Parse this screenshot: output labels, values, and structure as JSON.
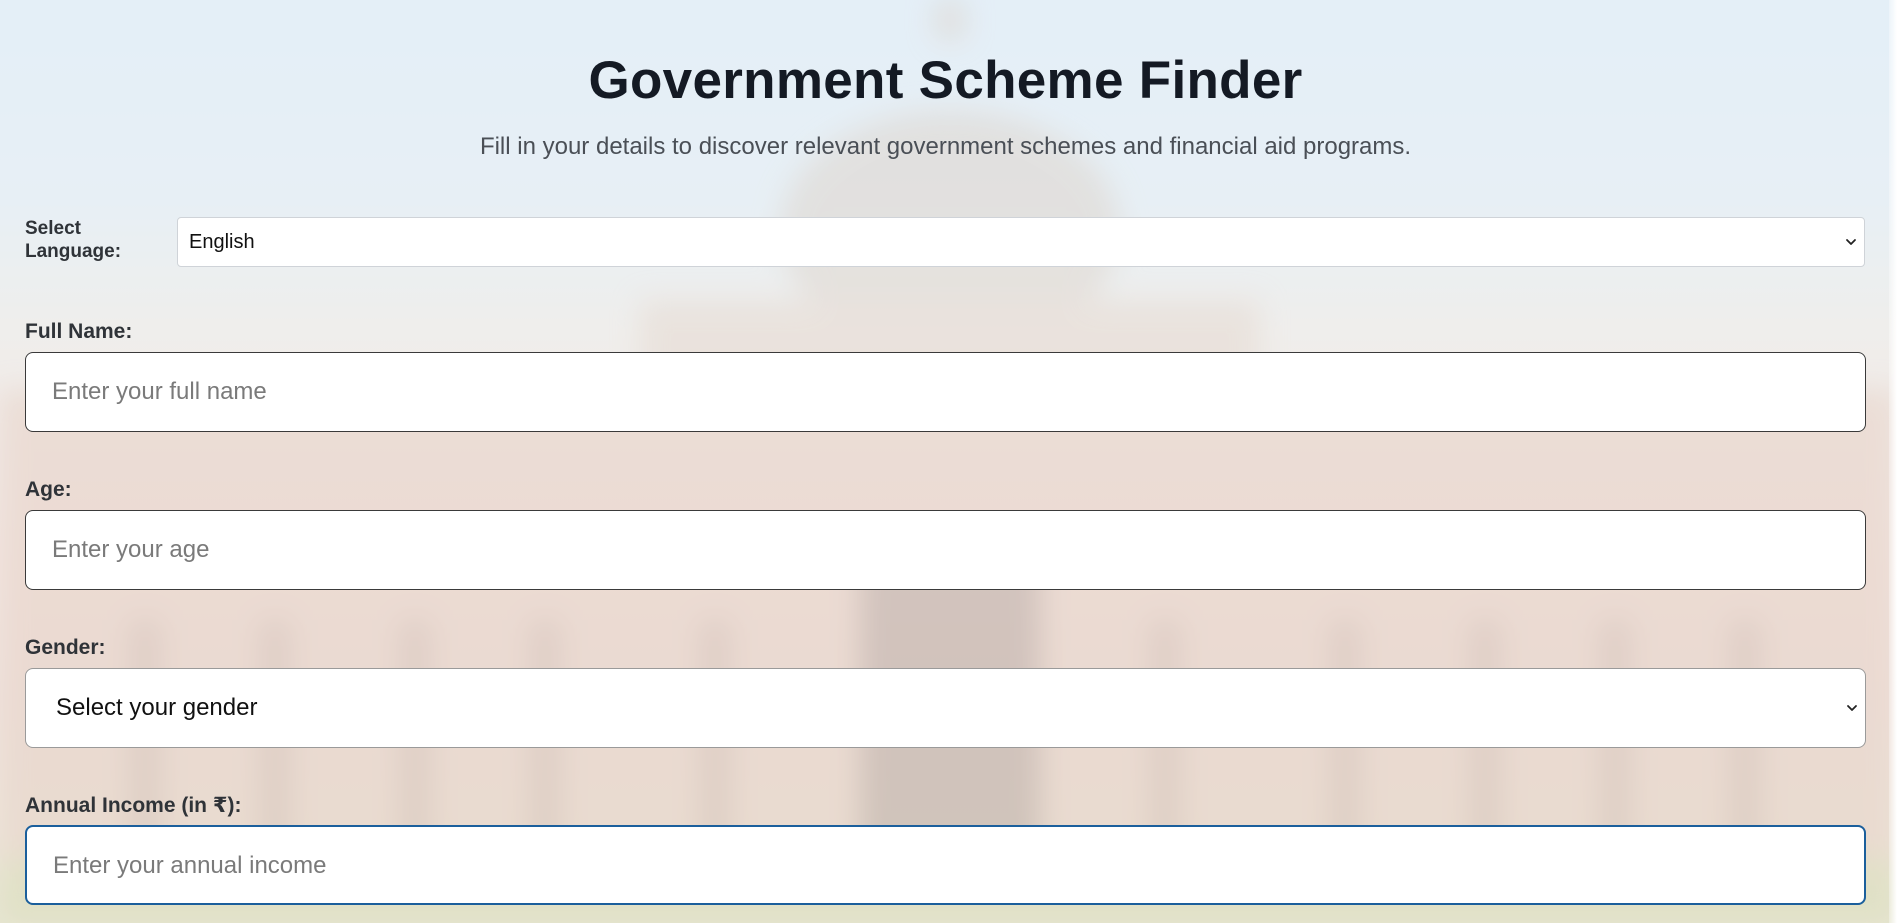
{
  "header": {
    "title": "Government Scheme Finder",
    "subtitle": "Fill in your details to discover relevant government schemes and financial aid programs."
  },
  "language": {
    "label_line1": "Select",
    "label_line2": "Language:",
    "selected": "English",
    "icon": "chevron-down-icon"
  },
  "form": {
    "full_name": {
      "label": "Full Name:",
      "placeholder": "Enter your full name",
      "value": ""
    },
    "age": {
      "label": "Age:",
      "placeholder": "Enter your age",
      "value": ""
    },
    "gender": {
      "label": "Gender:",
      "selected": "Select your gender",
      "icon": "chevron-down-icon"
    },
    "annual_income": {
      "label": "Annual Income (in ₹):",
      "placeholder": "Enter your annual income",
      "value": ""
    }
  },
  "colors": {
    "title": "#141a24",
    "subtitle": "#4a4f56",
    "focus_border": "#1b5f9c",
    "input_border": "#3a3a3a"
  }
}
